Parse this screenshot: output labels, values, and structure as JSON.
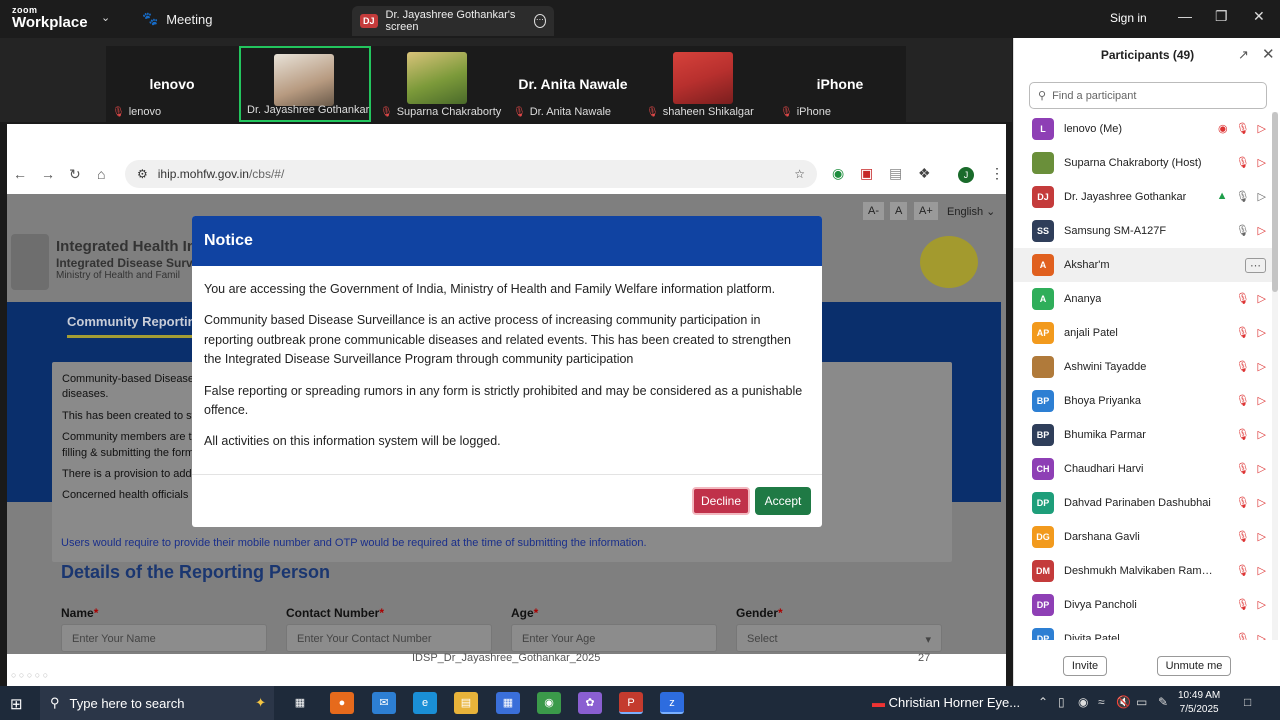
{
  "zoom": {
    "logo_top": "zoom",
    "logo_bottom": "Workplace",
    "meeting_label": "Meeting",
    "share_badge": "DJ",
    "share_label": "Dr. Jayashree Gothankar's screen",
    "signin_label": "Sign in"
  },
  "video_strip": [
    {
      "big": "lenovo",
      "label": "lenovo"
    },
    {
      "big": "",
      "label": "Dr. Jayashree Gothankar"
    },
    {
      "big": "",
      "label": "Suparna Chakraborty"
    },
    {
      "big": "Dr. Anita Nawale",
      "label": "Dr. Anita Nawale"
    },
    {
      "big": "",
      "label": "shaheen Shikalgar"
    },
    {
      "big": "iPhone",
      "label": "iPhone"
    }
  ],
  "browser": {
    "url_host": "ihip.mohfw.gov.in",
    "url_path": "/cbs/#/",
    "profile_initial": "J"
  },
  "website": {
    "acc_small": "A-",
    "acc_normal": "A",
    "acc_large": "A+",
    "language": "English",
    "title_1": "Integrated Health In",
    "title_2": "Integrated Disease Surv",
    "title_3": "Ministry of Health and Famil",
    "tab_community": "Community Reporting",
    "card_lines": [
      "Community-based Disease",
      "diseases.",
      "This has been created to st",
      "Community members are t",
      "filling & submitting the form",
      "There is a provision to add",
      "Concerned health officials"
    ],
    "blue_note": "Users would require to provide their mobile number and OTP would be required at the time of submitting the information.",
    "details_heading": "Details of the Reporting Person",
    "fields": [
      {
        "label": "Name",
        "placeholder": "Enter Your Name"
      },
      {
        "label": "Contact Number",
        "placeholder": "Enter Your Contact Number"
      },
      {
        "label": "Age",
        "placeholder": "Enter Your Age"
      },
      {
        "label": "Gender",
        "placeholder": "Select"
      }
    ],
    "slide_footer": "IDSP_Dr_Jayashree_Gothankar_2025",
    "slide_number": "27"
  },
  "modal": {
    "title": "Notice",
    "p1": "You are accessing the Government of India, Ministry of Health and Family Welfare information platform.",
    "p2": "Community based Disease Surveillance is an active process of increasing community participation in reporting outbreak prone communicable diseases and related events. This has been created to strengthen the Integrated Disease Surveillance Program through community participation",
    "p3": "False reporting or spreading rumors in any form is strictly prohibited and may be considered as a punishable offence.",
    "p4": "All activities on this information system will be logged.",
    "decline": "Decline",
    "accept": "Accept"
  },
  "participants": {
    "title": "Participants (49)",
    "search_placeholder": "Find a participant",
    "list": [
      {
        "initials": "L",
        "name": "lenovo (Me)",
        "color": "#8e3fb5"
      },
      {
        "initials": "",
        "name": "Suparna Chakraborty (Host)",
        "color": "#6a8f3a"
      },
      {
        "initials": "DJ",
        "name": "Dr. Jayashree Gothankar",
        "color": "#c43b3b"
      },
      {
        "initials": "SS",
        "name": "Samsung SM-A127F",
        "color": "#2f3e5a"
      },
      {
        "initials": "A",
        "name": "Akshar'm",
        "color": "#e0601f"
      },
      {
        "initials": "A",
        "name": "Ananya",
        "color": "#2fae5a"
      },
      {
        "initials": "AP",
        "name": "anjali Patel",
        "color": "#f29a1d"
      },
      {
        "initials": "",
        "name": "Ashwini Tayadde",
        "color": "#b07a3a"
      },
      {
        "initials": "BP",
        "name": "Bhoya Priyanka",
        "color": "#2d7fd3"
      },
      {
        "initials": "BP",
        "name": "Bhumika Parmar",
        "color": "#2f3e5a"
      },
      {
        "initials": "CH",
        "name": "Chaudhari Harvi",
        "color": "#8e3fb5"
      },
      {
        "initials": "DP",
        "name": "Dahvad Parinaben Dashubhai",
        "color": "#1e9e7a"
      },
      {
        "initials": "DG",
        "name": "Darshana Gavli",
        "color": "#f29a1d"
      },
      {
        "initials": "DM",
        "name": "Deshmukh Malvikaben Rameshb...",
        "color": "#c43b3b"
      },
      {
        "initials": "DP",
        "name": "Divya Pancholi",
        "color": "#8e3fb5"
      },
      {
        "initials": "DP",
        "name": "Divita Patel",
        "color": "#2d7fd3"
      }
    ],
    "invite_label": "Invite",
    "unmute_label": "Unmute me"
  },
  "taskbar": {
    "search_placeholder": "Type here to search",
    "news": "Christian Horner Eye...",
    "time": "10:49 AM",
    "date": "7/5/2025"
  },
  "colors": {
    "zoom_bar": "#1c1c1c",
    "modal_header": "#1043a2",
    "decline": "#c0314a",
    "accept": "#1f7a45",
    "active_tile": "#23c55e"
  }
}
